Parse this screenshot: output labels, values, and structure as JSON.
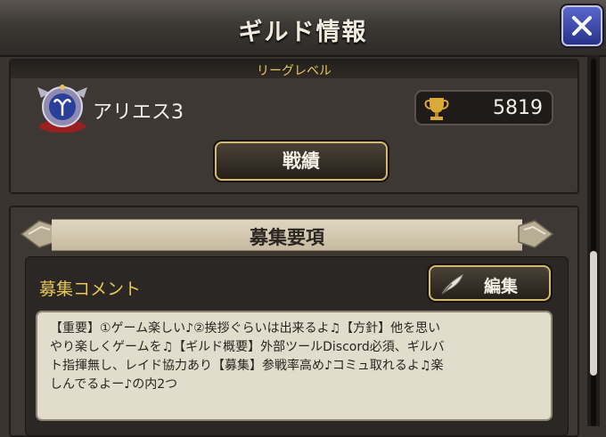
{
  "header": {
    "title": "ギルド情報",
    "close_icon": "close-icon"
  },
  "league": {
    "label": "リーグレベル",
    "name": "アリエス3",
    "trophy_icon": "trophy-icon",
    "trophy_value": "5819",
    "record_button": "戦績"
  },
  "recruit": {
    "banner_title": "募集要項",
    "comment_label": "募集コメント",
    "edit_button": "編集",
    "comment_text": "【重要】①ゲーム楽しい♪②挨拶ぐらいは出来るよ♫【方針】他を思い\nやり楽しくゲームを♫【ギルド概要】外部ツールDiscord必須、ギルバ\nト指揮無し、レイド協力あり【募集】参戦率高め♪コミュ取れるよ♫楽\nしんでるよー♪の内2つ"
  },
  "colors": {
    "accent_gold": "#e6c856",
    "close_blue": "#3a48b8"
  }
}
